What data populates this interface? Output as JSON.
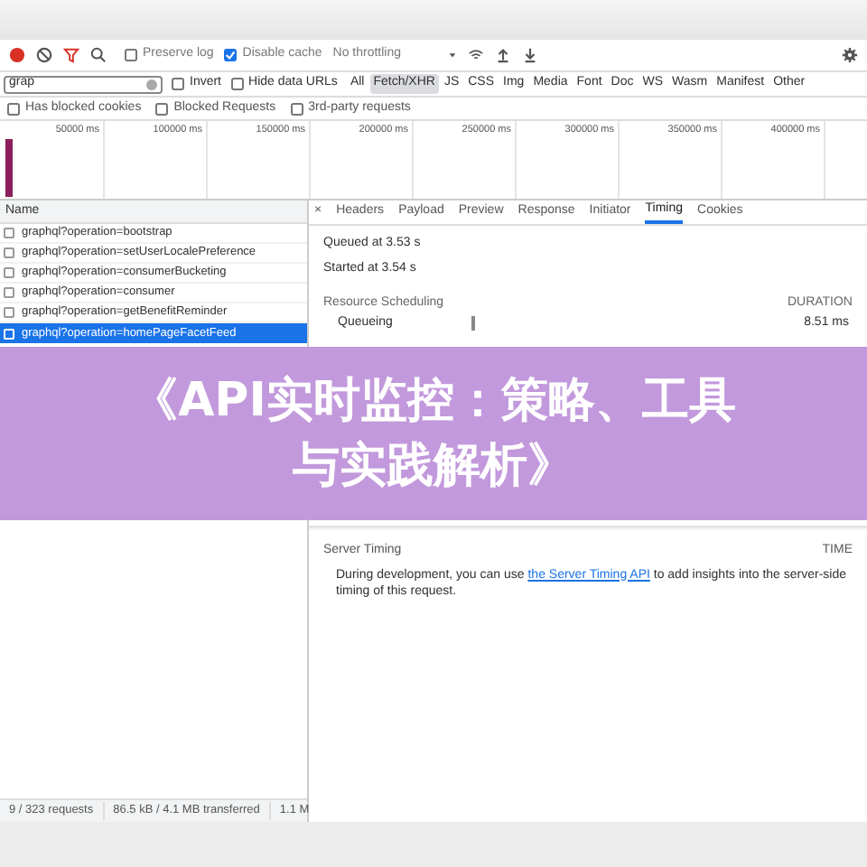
{
  "toolbar": {
    "preserve_log": false,
    "disable_cache": true,
    "throttling": "No throttling",
    "preserve_log_label": "Preserve log",
    "disable_cache_label": "Disable cache"
  },
  "filter": {
    "value": "grap",
    "invert": false,
    "invert_label": "Invert",
    "hide_data_urls": false,
    "hide_data_urls_label": "Hide data URLs",
    "types": [
      {
        "label": "All",
        "selected": false
      },
      {
        "label": "Fetch/XHR",
        "selected": true
      },
      {
        "label": "JS",
        "selected": false
      },
      {
        "label": "CSS",
        "selected": false
      },
      {
        "label": "Img",
        "selected": false
      },
      {
        "label": "Media",
        "selected": false
      },
      {
        "label": "Font",
        "selected": false
      },
      {
        "label": "Doc",
        "selected": false
      },
      {
        "label": "WS",
        "selected": false
      },
      {
        "label": "Wasm",
        "selected": false
      },
      {
        "label": "Manifest",
        "selected": false
      },
      {
        "label": "Other",
        "selected": false
      }
    ],
    "options": [
      {
        "label": "Has blocked cookies",
        "checked": false
      },
      {
        "label": "Blocked Requests",
        "checked": false
      },
      {
        "label": "3rd-party requests",
        "checked": false
      }
    ]
  },
  "timeline": {
    "ticks": [
      "50000 ms",
      "100000 ms",
      "150000 ms",
      "200000 ms",
      "250000 ms",
      "300000 ms",
      "350000 ms",
      "400000 ms"
    ]
  },
  "requests": {
    "column": "Name",
    "rows": [
      {
        "name": "graphql?operation=bootstrap",
        "selected": false
      },
      {
        "name": "graphql?operation=setUserLocalePreference",
        "selected": false
      },
      {
        "name": "graphql?operation=consumerBucketing",
        "selected": false
      },
      {
        "name": "graphql?operation=consumer",
        "selected": false
      },
      {
        "name": "graphql?operation=getBenefitReminder",
        "selected": false
      },
      {
        "name": "graphql?operation=homePageFacetFeed",
        "selected": true
      }
    ]
  },
  "details": {
    "close": "×",
    "tabs": [
      {
        "label": "Headers",
        "selected": false
      },
      {
        "label": "Payload",
        "selected": false
      },
      {
        "label": "Preview",
        "selected": false
      },
      {
        "label": "Response",
        "selected": false
      },
      {
        "label": "Initiator",
        "selected": false
      },
      {
        "label": "Timing",
        "selected": true
      },
      {
        "label": "Cookies",
        "selected": false
      }
    ],
    "queued": "Queued at 3.53 s",
    "started": "Started at 3.54 s",
    "sections": [
      {
        "title": "Resource Scheduling",
        "header": "DURATION",
        "rows": [
          {
            "label": "Queueing",
            "duration": "8.51 ms"
          }
        ]
      }
    ],
    "server_timing": {
      "title": "Server Timing",
      "header": "TIME",
      "text": "During development, you can use ",
      "link": "the Server Timing API",
      "text_after": " to add insights into the server-side timing of this request."
    }
  },
  "status_bar": [
    "9 / 323 requests",
    "86.5 kB / 4.1 MB transferred",
    "1.1 M"
  ],
  "banner": {
    "title": "《API实时监控：策略、工具与实践解析》"
  }
}
